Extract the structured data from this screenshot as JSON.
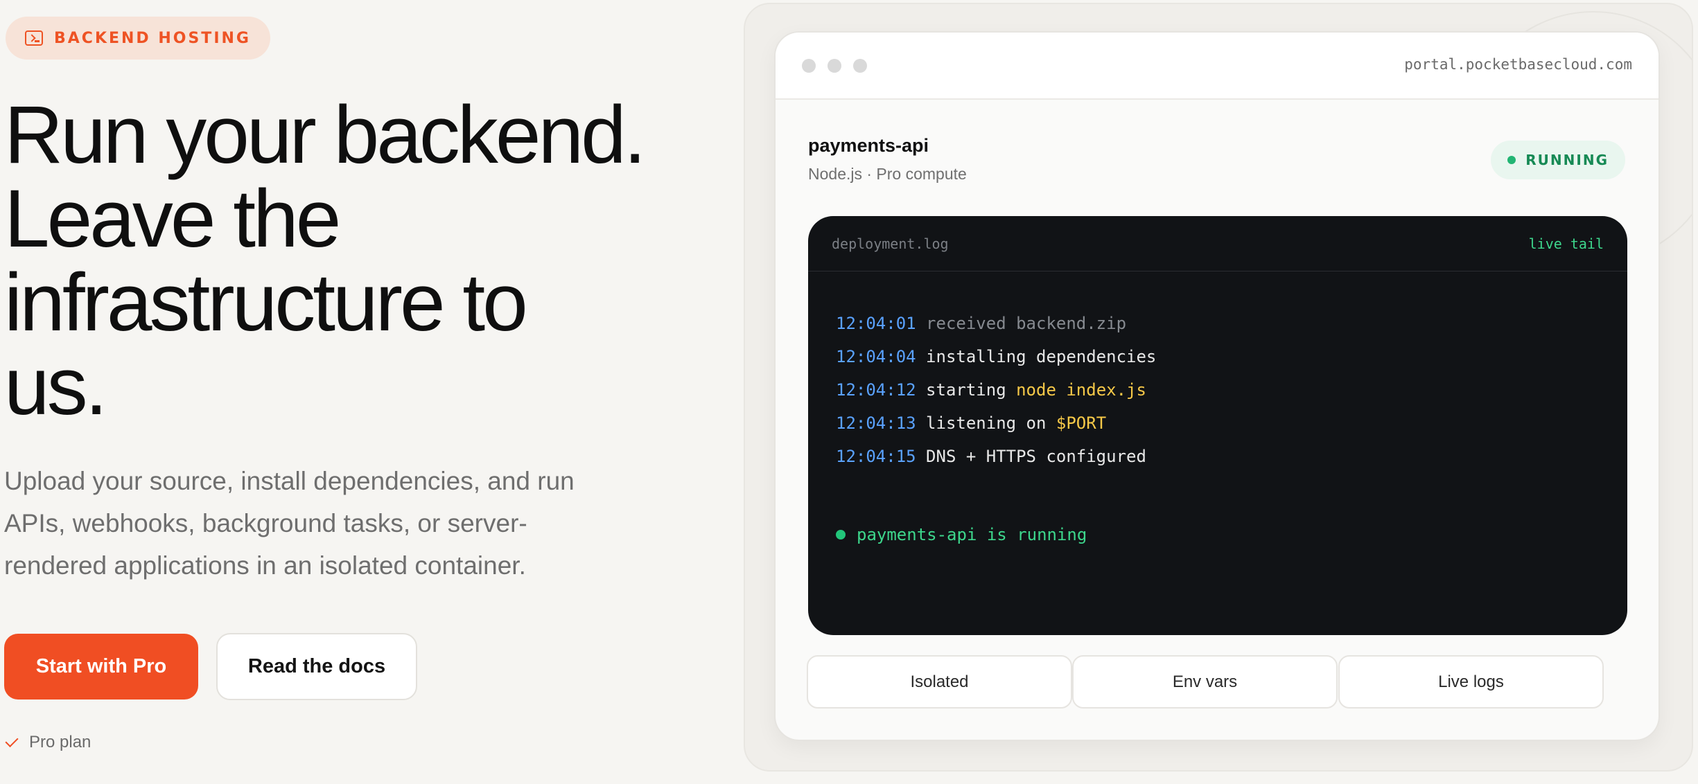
{
  "badge": {
    "icon": "terminal-icon",
    "label": "BACKEND HOSTING"
  },
  "hero": {
    "title_lines": [
      "Run your backend.",
      "Leave the",
      "infrastructure to",
      "us."
    ],
    "description_lines": [
      "Upload your source, install dependencies, and run",
      "APIs, webhooks, background tasks, or server-",
      "rendered applications in an isolated container."
    ]
  },
  "actions": {
    "primary_label": "Start with Pro",
    "secondary_label": "Read the docs"
  },
  "plan_note": {
    "icon": "check-icon",
    "label": "Pro plan"
  },
  "browser": {
    "url": "portal.pocketbasecloud.com"
  },
  "service": {
    "name": "payments-api",
    "meta": "Node.js · Pro compute",
    "status": "RUNNING"
  },
  "terminal": {
    "file": "deployment.log",
    "mode": "live tail",
    "lines": [
      {
        "time": "12:04:01",
        "parts": [
          {
            "text": "received backend.zip",
            "style": "muted"
          }
        ]
      },
      {
        "time": "12:04:04",
        "parts": [
          {
            "text": "installing dependencies",
            "style": "plain"
          }
        ]
      },
      {
        "time": "12:04:12",
        "parts": [
          {
            "text": "starting ",
            "style": "plain"
          },
          {
            "text": "node index.js",
            "style": "hl"
          }
        ]
      },
      {
        "time": "12:04:13",
        "parts": [
          {
            "text": "listening on ",
            "style": "plain"
          },
          {
            "text": "$PORT",
            "style": "hl"
          }
        ]
      },
      {
        "time": "12:04:15",
        "parts": [
          {
            "text": "DNS + HTTPS configured",
            "style": "plain"
          }
        ]
      }
    ],
    "final": "payments-api is running"
  },
  "features": [
    "Isolated",
    "Env vars",
    "Live logs"
  ],
  "colors": {
    "accent": "#f04e23",
    "success": "#22b573",
    "timestamp": "#5aa2ff",
    "highlight": "#f7c948"
  }
}
